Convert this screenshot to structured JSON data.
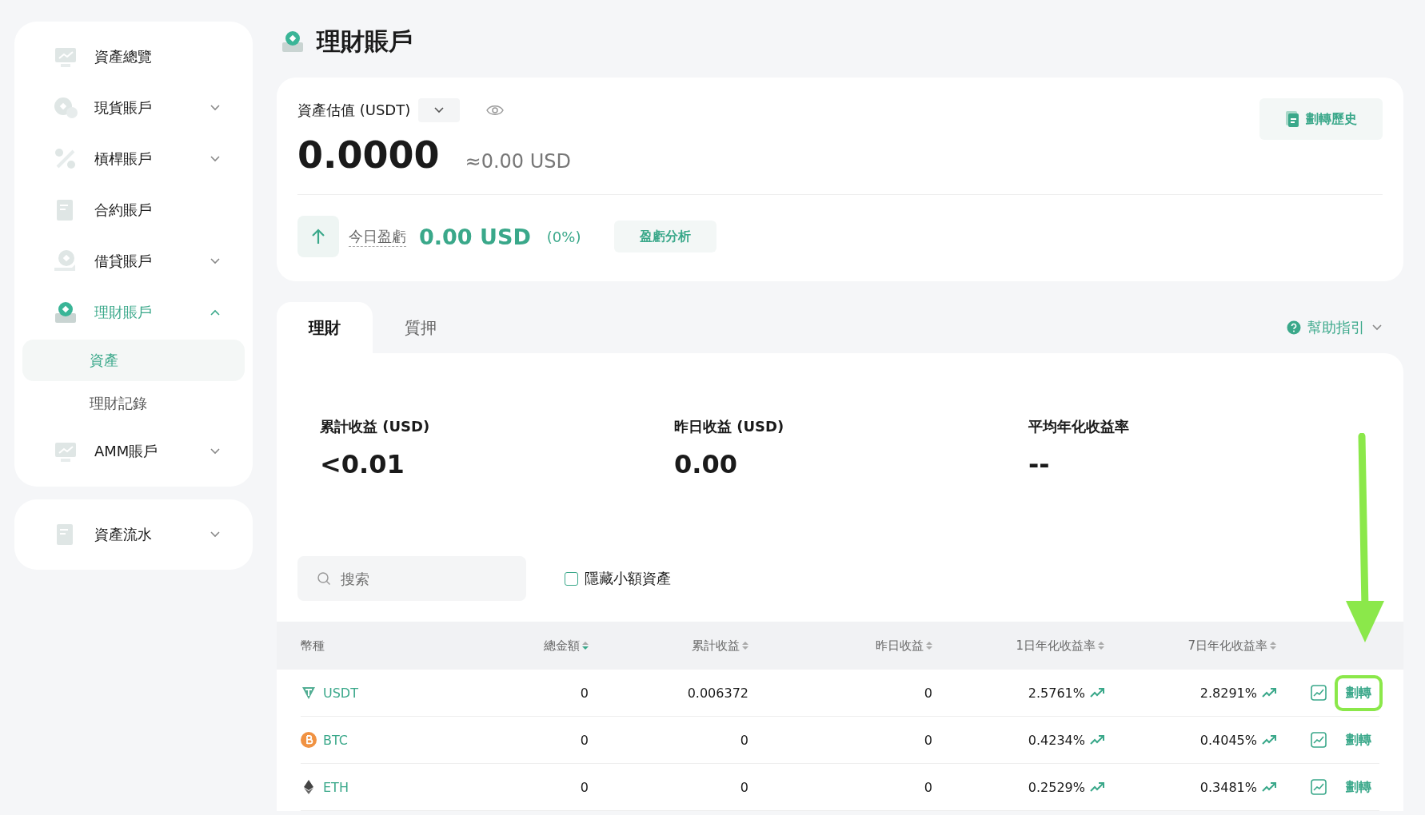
{
  "sidebar": {
    "groups": [
      {
        "items": [
          {
            "label": "資產總覽",
            "selected": false
          },
          {
            "label": "現貨賬戶",
            "expanded": false,
            "selected": false
          },
          {
            "label": "槓桿賬戶",
            "expanded": false,
            "selected": false
          },
          {
            "label": "合約賬戶",
            "selected": false
          },
          {
            "label": "借貸賬戶",
            "expanded": false,
            "selected": false
          },
          {
            "label": "理財賬戶",
            "expanded": true,
            "selected": true,
            "children": [
              {
                "label": "資產",
                "selected": true
              },
              {
                "label": "理財記錄",
                "selected": false
              }
            ]
          },
          {
            "label": "AMM賬戶",
            "expanded": false,
            "selected": false
          }
        ]
      },
      {
        "items": [
          {
            "label": "資產流水",
            "expanded": false,
            "selected": false
          }
        ]
      }
    ]
  },
  "page_title": "理財賬戶",
  "summary": {
    "label": "資產估值 (USDT)",
    "value": "0.0000",
    "approx": "≈0.00 USD",
    "history_button": "劃轉歷史",
    "pnl_label": "今日盈虧",
    "pnl_value": "0.00 USD",
    "pnl_percent": "(0%)",
    "analysis_button": "盈虧分析"
  },
  "tabs": [
    {
      "label": "理財",
      "selected": true
    },
    {
      "label": "質押",
      "selected": false
    }
  ],
  "help_link": "幫助指引",
  "stats": [
    {
      "label": "累計收益 (USD)",
      "value": "<0.01"
    },
    {
      "label": "昨日收益 (USD)",
      "value": "0.00"
    },
    {
      "label": "平均年化收益率",
      "value": "--"
    }
  ],
  "search": {
    "placeholder": "搜索"
  },
  "hide_small": {
    "label": "隱藏小額資產",
    "checked": false
  },
  "table": {
    "columns": [
      {
        "label": "幣種",
        "kind": "plain"
      },
      {
        "label": "總金額",
        "kind": "sortable",
        "sorted": true
      },
      {
        "label": "累計收益",
        "kind": "sortable",
        "sorted": false
      },
      {
        "label": "昨日收益",
        "kind": "sortable",
        "sorted": false
      },
      {
        "label": "1日年化收益率",
        "kind": "sortable",
        "sorted": false
      },
      {
        "label": "7日年化收益率",
        "kind": "sortable",
        "sorted": false
      }
    ],
    "rows": [
      {
        "coin": "USDT",
        "kind": "usdt",
        "total": "0",
        "cumulative": "0.006372",
        "yesterday": "0",
        "apr1": "2.5761%",
        "apr7": "2.8291%",
        "action": "劃轉",
        "highlighted": true
      },
      {
        "coin": "BTC",
        "kind": "btc",
        "total": "0",
        "cumulative": "0",
        "yesterday": "0",
        "apr1": "0.4234%",
        "apr7": "0.4045%",
        "action": "劃轉",
        "highlighted": false
      },
      {
        "coin": "ETH",
        "kind": "eth",
        "total": "0",
        "cumulative": "0",
        "yesterday": "0",
        "apr1": "0.2529%",
        "apr7": "0.3481%",
        "action": "劃轉",
        "highlighted": false
      }
    ]
  }
}
